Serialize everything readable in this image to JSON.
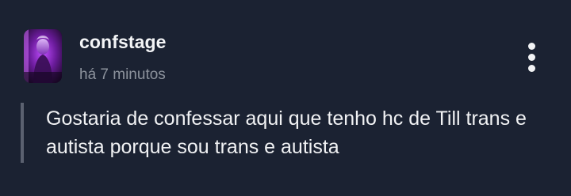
{
  "post": {
    "username": "confstage",
    "timestamp": "há 7 minutos",
    "body": "Gostaria de confessar aqui que tenho hc de Till trans e autista porque sou trans e autista"
  },
  "icons": {
    "avatar": "profile-avatar",
    "menu": "more-vertical-icon"
  },
  "colors": {
    "background": "#1b2232",
    "text_primary": "#f1f2f4",
    "text_secondary": "#8c929c",
    "quote_bar": "#5b6170",
    "avatar_accent": "#b43cff"
  }
}
